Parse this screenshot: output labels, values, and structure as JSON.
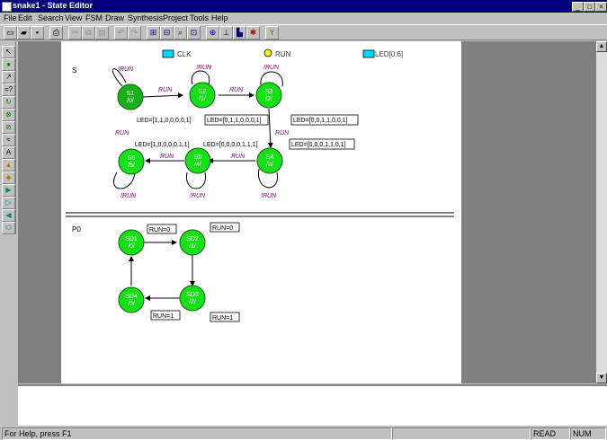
{
  "window": {
    "title": "snake1 - State Editor",
    "minimize": "_",
    "maximize": "□",
    "close": "×"
  },
  "menu": [
    "File",
    "Edit",
    "Search",
    "View",
    "FSM",
    "Draw",
    "Synthesis",
    "Project",
    "Tools",
    "Help"
  ],
  "toolbar": {
    "new": "▭",
    "open": "▰",
    "save": "▪",
    "print": "⎙",
    "cut": "✂",
    "copy": "⧉",
    "paste": "▤",
    "undo": "↶",
    "redo": "↷",
    "t1": "⊞",
    "t2": "⊟",
    "t3": "⌕",
    "t4": "⊡",
    "t5": "⊕",
    "t6": "⊥",
    "t7": "▙",
    "t8": "✱",
    "t9": "Y"
  },
  "palette": [
    "↖",
    "●",
    "↗",
    "=?",
    "↻",
    "⊗",
    "⊘",
    "≈",
    "A",
    "▲",
    "◆",
    "▶",
    "▷",
    "◀",
    "⬭"
  ],
  "ports": {
    "clk": "CLK",
    "run": "RUN",
    "led": "LED[0:6]"
  },
  "fsm1": {
    "label": "S",
    "states": [
      {
        "name": "S1",
        "code": "/0/"
      },
      {
        "name": "S2",
        "code": "/1/"
      },
      {
        "name": "S3",
        "code": "/2/"
      },
      {
        "name": "S4",
        "code": "/3/"
      },
      {
        "name": "S5",
        "code": "/4/"
      },
      {
        "name": "S6",
        "code": "/5/"
      }
    ],
    "transitions": [
      "RUN",
      "RUN",
      "RUN",
      "RUN",
      "RUN",
      "RUN"
    ],
    "self_loops": [
      "!RUN",
      "!RUN",
      "!RUN",
      "!RUN",
      "!RUN",
      "!RUN"
    ],
    "actions": [
      "LED=[1,1,0,0,0,0,1]",
      "LED=[0,1,1,0,0,0,1]",
      "LED=[0,0,1,1,0,0,1]",
      "LED=[0,0,0,1,1,0,1]",
      "LED=[0,0,0,0,1,1,1]",
      "LED=[1,0,0,0,0,1,1]"
    ],
    "reset_label": "RUN"
  },
  "fsm2": {
    "label": "P0",
    "states": [
      {
        "name": "SD1",
        "code": "/0/"
      },
      {
        "name": "SD2",
        "code": "/1/"
      },
      {
        "name": "SD3",
        "code": "/2/"
      },
      {
        "name": "SD4",
        "code": "/3/"
      }
    ],
    "conditions": [
      "RUN=0",
      "RUN=0",
      "RUN=1",
      "RUN=1"
    ]
  },
  "status": {
    "help": "For Help, press F1",
    "pos": "",
    "mode": "READ",
    "ovr": "NUM"
  },
  "colors": {
    "state_fill": "#18e018",
    "state_stroke": "#106010",
    "action": "#000000",
    "condition": "#800080",
    "titlebar": "#000080"
  }
}
